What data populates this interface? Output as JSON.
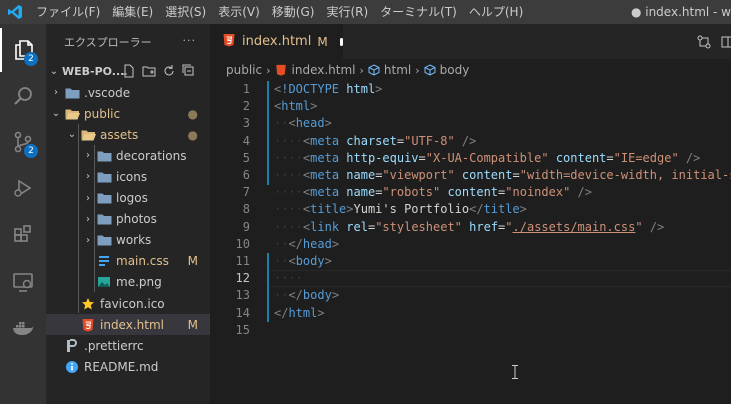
{
  "titlebar": {
    "menu": [
      "ファイル(F)",
      "編集(E)",
      "選択(S)",
      "表示(V)",
      "移動(G)",
      "実行(R)",
      "ターミナル(T)",
      "ヘルプ(H)"
    ],
    "window_title": "● index.html - w"
  },
  "activity": {
    "explorer_badge": "2",
    "scm_badge": "2"
  },
  "sidebar": {
    "header": "エクスプローラー",
    "more": "···",
    "root": "WEB-PO...",
    "items": [
      {
        "label": "vscode",
        "prefix": ".",
        "indent": 1,
        "kind": "folder",
        "chev": "›"
      },
      {
        "label": "public",
        "indent": 1,
        "kind": "folder-open",
        "chev": "⌄",
        "dec": "●",
        "color": "#e2c08d"
      },
      {
        "label": "assets",
        "indent": 2,
        "kind": "folder-open",
        "chev": "⌄",
        "dec": "●",
        "color": "#e2c08d"
      },
      {
        "label": "decorations",
        "indent": 3,
        "kind": "folder",
        "chev": "›"
      },
      {
        "label": "icons",
        "indent": 3,
        "kind": "folder",
        "chev": "›"
      },
      {
        "label": "logos",
        "indent": 3,
        "kind": "folder",
        "chev": "›"
      },
      {
        "label": "photos",
        "indent": 3,
        "kind": "folder",
        "chev": "›"
      },
      {
        "label": "works",
        "indent": 3,
        "kind": "folder",
        "chev": "›"
      },
      {
        "label": "main.css",
        "indent": 3,
        "kind": "css",
        "dec": "M",
        "color": "#e2c08d"
      },
      {
        "label": "me.png",
        "indent": 3,
        "kind": "img"
      },
      {
        "label": "favicon.ico",
        "indent": 2,
        "kind": "star"
      },
      {
        "label": "index.html",
        "indent": 2,
        "kind": "html",
        "dec": "M",
        "color": "#e2c08d",
        "selected": true
      },
      {
        "label": "prettierrc",
        "prefix": ".",
        "indent": 1,
        "kind": "prettier"
      },
      {
        "label": "README.md",
        "indent": 1,
        "kind": "info"
      }
    ]
  },
  "tab": {
    "label": "index.html",
    "status": "M"
  },
  "breadcrumb": [
    "public",
    "index.html",
    "html",
    "body"
  ],
  "editor": {
    "lines": [
      {
        "n": "1",
        "toks": [
          [
            "t-pun",
            "<"
          ],
          [
            "t-tag",
            "!DOCTYPE"
          ],
          [
            "t-txt",
            " "
          ],
          [
            "t-attr",
            "html"
          ],
          [
            "t-pun",
            ">"
          ]
        ]
      },
      {
        "n": "2",
        "toks": [
          [
            "t-pun",
            "<"
          ],
          [
            "t-tag",
            "html"
          ],
          [
            "t-pun",
            ">"
          ]
        ]
      },
      {
        "n": "3",
        "toks": [
          [
            "t-ws",
            "··"
          ],
          [
            "t-pun",
            "<"
          ],
          [
            "t-tag",
            "head"
          ],
          [
            "t-pun",
            ">"
          ]
        ]
      },
      {
        "n": "4",
        "toks": [
          [
            "t-ws",
            "····"
          ],
          [
            "t-pun",
            "<"
          ],
          [
            "t-tag",
            "meta"
          ],
          [
            "t-txt",
            " "
          ],
          [
            "t-attr",
            "charset"
          ],
          [
            "t-txt",
            "="
          ],
          [
            "t-str",
            "\"UTF-8\""
          ],
          [
            "t-txt",
            " "
          ],
          [
            "t-pun",
            "/>"
          ]
        ]
      },
      {
        "n": "5",
        "toks": [
          [
            "t-ws",
            "····"
          ],
          [
            "t-pun",
            "<"
          ],
          [
            "t-tag",
            "meta"
          ],
          [
            "t-txt",
            " "
          ],
          [
            "t-attr",
            "http-equiv"
          ],
          [
            "t-txt",
            "="
          ],
          [
            "t-str",
            "\"X-UA-Compatible\""
          ],
          [
            "t-txt",
            " "
          ],
          [
            "t-attr",
            "content"
          ],
          [
            "t-txt",
            "="
          ],
          [
            "t-str",
            "\"IE=edge\""
          ],
          [
            "t-txt",
            " "
          ],
          [
            "t-pun",
            "/>"
          ]
        ]
      },
      {
        "n": "6",
        "toks": [
          [
            "t-ws",
            "····"
          ],
          [
            "t-pun",
            "<"
          ],
          [
            "t-tag",
            "meta"
          ],
          [
            "t-txt",
            " "
          ],
          [
            "t-attr",
            "name"
          ],
          [
            "t-txt",
            "="
          ],
          [
            "t-str",
            "\"viewport\""
          ],
          [
            "t-txt",
            " "
          ],
          [
            "t-attr",
            "content"
          ],
          [
            "t-txt",
            "="
          ],
          [
            "t-str",
            "\"width=device-width, initial-s"
          ]
        ]
      },
      {
        "n": "7",
        "toks": [
          [
            "t-ws",
            "····"
          ],
          [
            "t-pun",
            "<"
          ],
          [
            "t-tag",
            "meta"
          ],
          [
            "t-txt",
            " "
          ],
          [
            "t-attr",
            "name"
          ],
          [
            "t-txt",
            "="
          ],
          [
            "t-str",
            "\"robots\""
          ],
          [
            "t-txt",
            " "
          ],
          [
            "t-attr",
            "content"
          ],
          [
            "t-txt",
            "="
          ],
          [
            "t-str",
            "\"noindex\""
          ],
          [
            "t-txt",
            " "
          ],
          [
            "t-pun",
            "/>"
          ]
        ]
      },
      {
        "n": "8",
        "toks": [
          [
            "t-ws",
            "····"
          ],
          [
            "t-pun",
            "<"
          ],
          [
            "t-tag",
            "title"
          ],
          [
            "t-pun",
            ">"
          ],
          [
            "t-txt",
            "Yumi's Portfolio"
          ],
          [
            "t-pun",
            "</"
          ],
          [
            "t-tag",
            "title"
          ],
          [
            "t-pun",
            ">"
          ]
        ]
      },
      {
        "n": "9",
        "toks": [
          [
            "t-ws",
            "····"
          ],
          [
            "t-pun",
            "<"
          ],
          [
            "t-tag",
            "link"
          ],
          [
            "t-txt",
            " "
          ],
          [
            "t-attr",
            "rel"
          ],
          [
            "t-txt",
            "="
          ],
          [
            "t-str",
            "\"stylesheet\""
          ],
          [
            "t-txt",
            " "
          ],
          [
            "t-attr",
            "href"
          ],
          [
            "t-txt",
            "="
          ],
          [
            "t-str",
            "\""
          ],
          [
            "t-link",
            "./assets/main.css"
          ],
          [
            "t-str",
            "\""
          ],
          [
            "t-txt",
            " "
          ],
          [
            "t-pun",
            "/>"
          ]
        ]
      },
      {
        "n": "10",
        "toks": [
          [
            "t-ws",
            "··"
          ],
          [
            "t-pun",
            "</"
          ],
          [
            "t-tag",
            "head"
          ],
          [
            "t-pun",
            ">"
          ]
        ]
      },
      {
        "n": "11",
        "toks": [
          [
            "t-ws",
            "··"
          ],
          [
            "t-pun",
            "<"
          ],
          [
            "t-tag",
            "body"
          ],
          [
            "t-pun",
            ">"
          ]
        ]
      },
      {
        "n": "12",
        "toks": [
          [
            "t-ws",
            "····"
          ]
        ],
        "current": true
      },
      {
        "n": "13",
        "toks": [
          [
            "t-ws",
            "··"
          ],
          [
            "t-pun",
            "</"
          ],
          [
            "t-tag",
            "body"
          ],
          [
            "t-pun",
            ">"
          ]
        ]
      },
      {
        "n": "14",
        "toks": [
          [
            "t-pun",
            "</"
          ],
          [
            "t-tag",
            "html"
          ],
          [
            "t-pun",
            ">"
          ]
        ]
      },
      {
        "n": "15",
        "toks": []
      }
    ]
  }
}
